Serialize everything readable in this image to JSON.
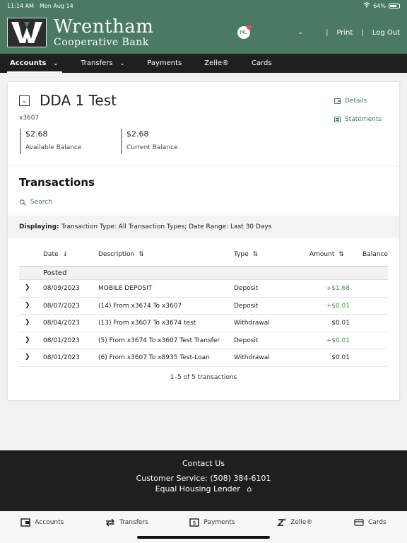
{
  "status": {
    "time": "11:14 AM",
    "date": "Mon Aug 14",
    "battery": "64%"
  },
  "header": {
    "brand_line1": "Wrentham",
    "brand_line2": "Cooperative Bank",
    "avatar_initials": "ML",
    "print_label": "Print",
    "logout_label": "Log Out"
  },
  "nav": {
    "items": [
      {
        "label": "Accounts"
      },
      {
        "label": "Transfers"
      },
      {
        "label": "Payments"
      },
      {
        "label": "Zelle®"
      },
      {
        "label": "Cards"
      }
    ]
  },
  "account": {
    "name": "DDA 1 Test",
    "number": "x3607",
    "available_value": "$2.68",
    "available_label": "Available Balance",
    "current_value": "$2.68",
    "current_label": "Current Balance",
    "details_label": "Details",
    "statements_label": "Statements"
  },
  "transactions": {
    "title": "Transactions",
    "search_label": "Search",
    "filter_prefix": "Displaying:",
    "filter_text": "Transaction Type: All Transaction Types; Date Range: Last 30 Days",
    "columns": {
      "date": "Date",
      "description": "Description",
      "type": "Type",
      "amount": "Amount",
      "balance": "Balance"
    },
    "group_label": "Posted",
    "rows": [
      {
        "date": "08/09/2023",
        "description": "MOBILE DEPOSIT",
        "type": "Deposit",
        "amount": "+$1.68"
      },
      {
        "date": "08/07/2023",
        "description": "(14) From x3674 To x3607",
        "type": "Deposit",
        "amount": "+$0.01"
      },
      {
        "date": "08/04/2023",
        "description": "(13) From x3607 To x3674 test",
        "type": "Withdrawal",
        "amount": "$0.01"
      },
      {
        "date": "08/01/2023",
        "description": "(5) From x3674 To x3607 Test Transfer",
        "type": "Deposit",
        "amount": "+$0.01"
      },
      {
        "date": "08/01/2023",
        "description": "(6) From x3607 To x8935 Test-Loan",
        "type": "Withdrawal",
        "amount": "$0.01"
      }
    ],
    "pager": "1–5 of 5 transactions"
  },
  "footer": {
    "contact": "Contact Us",
    "service": "Customer Service: (508) 384-6101",
    "lender": "Equal Housing Lender"
  },
  "tabbar": {
    "items": [
      {
        "label": "Accounts"
      },
      {
        "label": "Transfers"
      },
      {
        "label": "Payments"
      },
      {
        "label": "Zelle®"
      },
      {
        "label": "Cards"
      }
    ]
  },
  "colors": {
    "brand_green": "#4a7a64",
    "dark": "#1f1f1f",
    "positive": "#4a8a4a"
  }
}
